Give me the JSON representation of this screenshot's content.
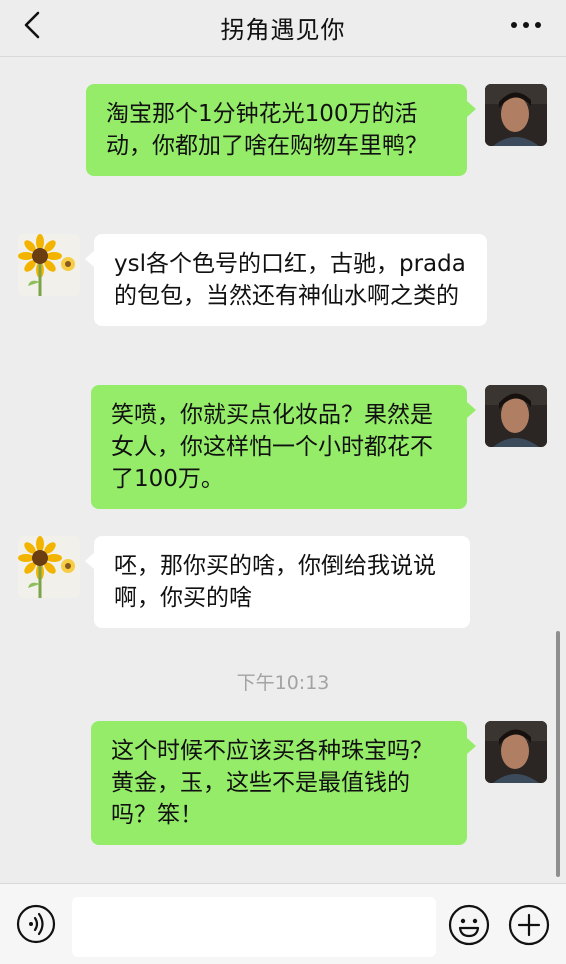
{
  "header": {
    "title": "拐角遇见你",
    "back_icon": "chevron-left-icon",
    "more_icon": "more-dots-icon"
  },
  "messages": [
    {
      "from": "me",
      "text": "淘宝那个1分钟花光100万的活动，你都加了啥在购物车里鸭？"
    },
    {
      "from": "other",
      "text": "ysl各个色号的口红，古驰，prada的包包，当然还有神仙水啊之类的"
    },
    {
      "from": "me",
      "text": "笑喷，你就买点化妆品？果然是女人，你这样怕一个小时都花不了100万。"
    },
    {
      "from": "other",
      "text": "呸，那你买的啥，你倒给我说说啊，你买的啥"
    },
    {
      "from": "me",
      "text": "这个时候不应该买各种珠宝吗？黄金，玉，这些不是最值钱的吗？笨！"
    }
  ],
  "timestamp": "下午10:13",
  "input_bar": {
    "voice_icon": "voice-icon",
    "emoji_icon": "emoji-icon",
    "plus_icon": "plus-icon",
    "input_value": ""
  },
  "colors": {
    "background": "#ededed",
    "my_bubble": "#95ec69",
    "other_bubble": "#ffffff"
  }
}
